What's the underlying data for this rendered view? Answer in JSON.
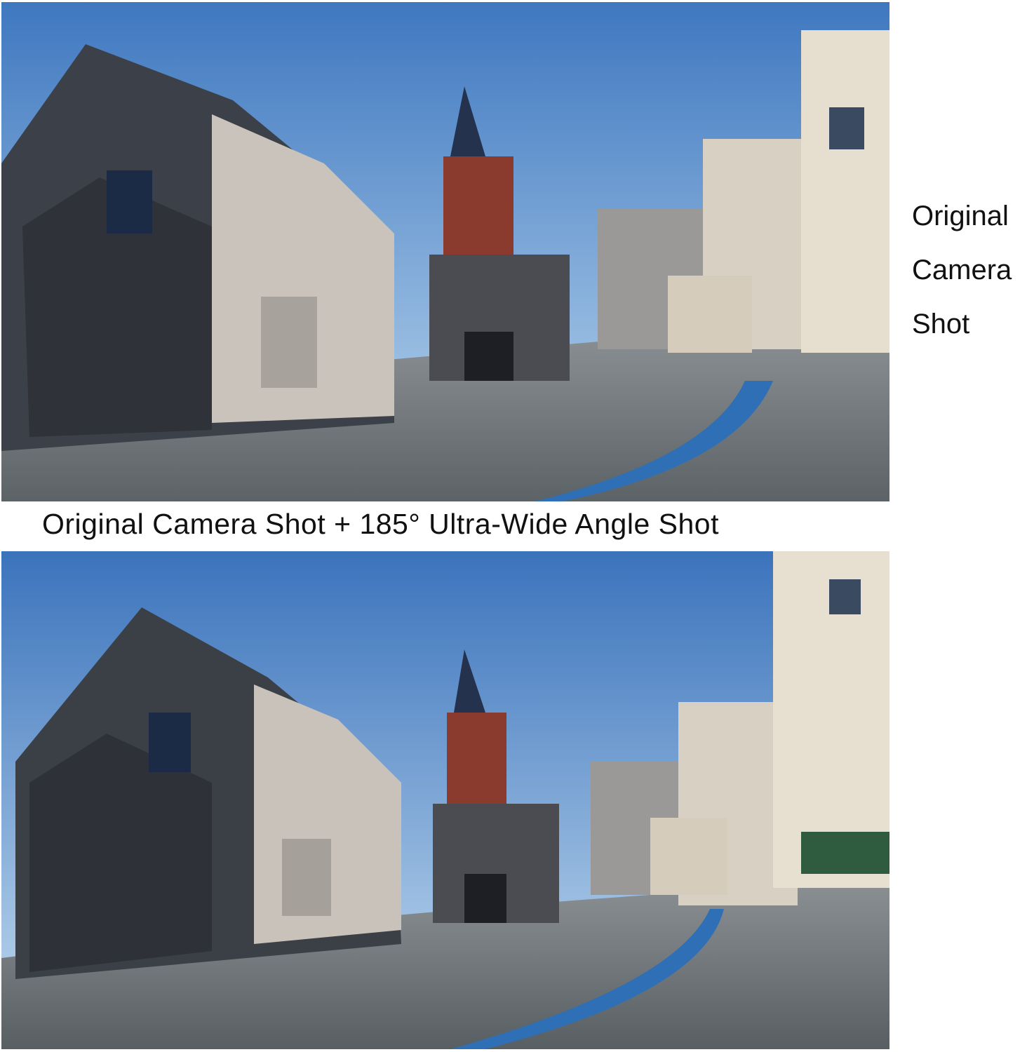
{
  "side_label": {
    "lines": [
      "Original",
      "Camera",
      "Shot"
    ]
  },
  "caption": {
    "text": "Original Camera Shot + 185° Ultra-Wide Angle Shot"
  },
  "colors": {
    "sky_top": "#4f86c9",
    "sky_bottom": "#b9d6ee",
    "pavement": "#6e7478",
    "church_brick": "#8a3b2e",
    "blue_stripe": "#2f6fb5"
  }
}
